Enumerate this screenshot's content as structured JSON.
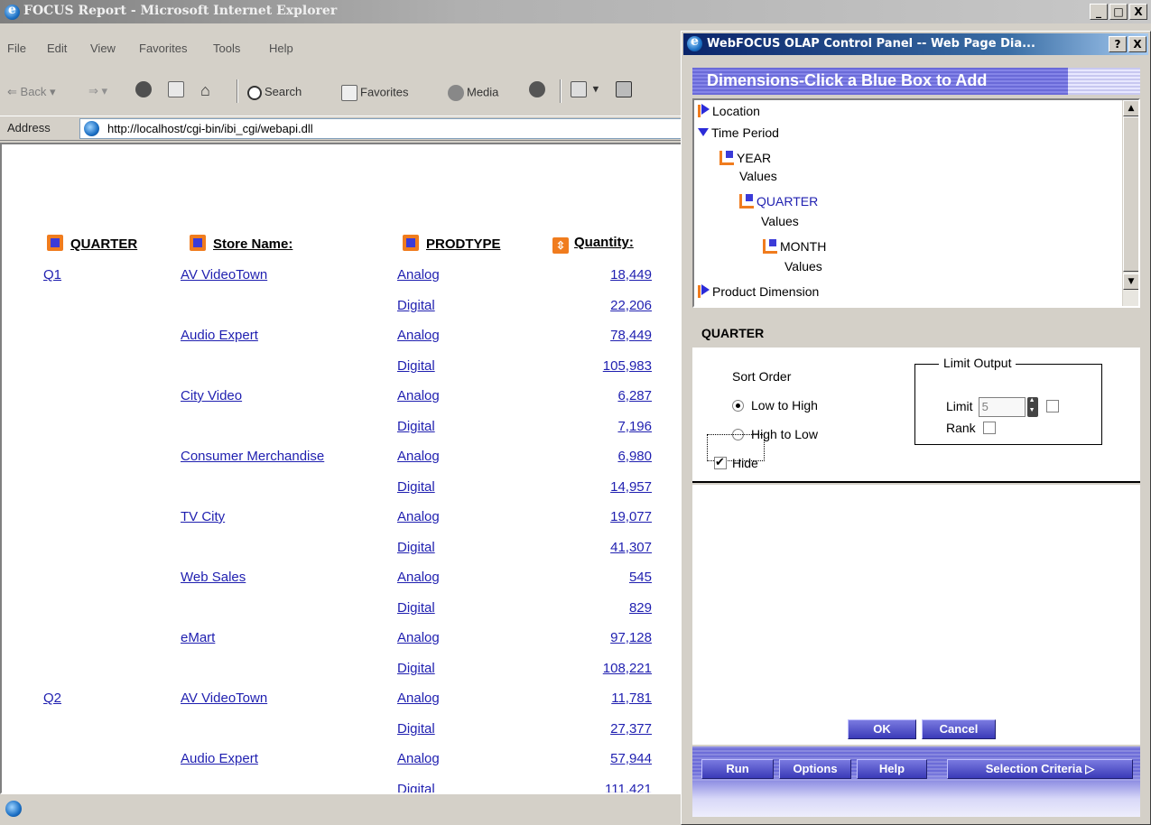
{
  "browser": {
    "title": "FOCUS Report - Microsoft Internet Explorer",
    "window_buttons": [
      "_",
      "□",
      "X"
    ],
    "menu": [
      "File",
      "Edit",
      "View",
      "Favorites",
      "Tools",
      "Help"
    ],
    "toolbar": {
      "back": "Back",
      "search": "Search",
      "favorites": "Favorites",
      "media": "Media"
    },
    "address_label": "Address",
    "address_url": "http://localhost/cgi-bin/ibi_cgi/webapi.dll"
  },
  "report": {
    "headers": {
      "quarter": "QUARTER",
      "store": "Store Name:",
      "prodtype": "PRODTYPE",
      "quantity": "Quantity:"
    },
    "rows": [
      {
        "quarter": "Q1",
        "store": "AV VideoTown",
        "prodtype": "Analog",
        "quantity": "18,449"
      },
      {
        "quarter": "",
        "store": "",
        "prodtype": "Digital",
        "quantity": "22,206"
      },
      {
        "quarter": "",
        "store": "Audio Expert",
        "prodtype": "Analog",
        "quantity": "78,449"
      },
      {
        "quarter": "",
        "store": "",
        "prodtype": "Digital",
        "quantity": "105,983"
      },
      {
        "quarter": "",
        "store": "City Video",
        "prodtype": "Analog",
        "quantity": "6,287"
      },
      {
        "quarter": "",
        "store": "",
        "prodtype": "Digital",
        "quantity": "7,196"
      },
      {
        "quarter": "",
        "store": "Consumer Merchandise",
        "prodtype": "Analog",
        "quantity": "6,980"
      },
      {
        "quarter": "",
        "store": "",
        "prodtype": "Digital",
        "quantity": "14,957"
      },
      {
        "quarter": "",
        "store": "TV City",
        "prodtype": "Analog",
        "quantity": "19,077"
      },
      {
        "quarter": "",
        "store": "",
        "prodtype": "Digital",
        "quantity": "41,307"
      },
      {
        "quarter": "",
        "store": "Web Sales",
        "prodtype": "Analog",
        "quantity": "545"
      },
      {
        "quarter": "",
        "store": "",
        "prodtype": "Digital",
        "quantity": "829"
      },
      {
        "quarter": "",
        "store": "eMart",
        "prodtype": "Analog",
        "quantity": "97,128"
      },
      {
        "quarter": "",
        "store": "",
        "prodtype": "Digital",
        "quantity": "108,221"
      },
      {
        "quarter": "Q2",
        "store": "AV VideoTown",
        "prodtype": "Analog",
        "quantity": "11,781"
      },
      {
        "quarter": "",
        "store": "",
        "prodtype": "Digital",
        "quantity": "27,377"
      },
      {
        "quarter": "",
        "store": "Audio Expert",
        "prodtype": "Analog",
        "quantity": "57,944"
      },
      {
        "quarter": "",
        "store": "",
        "prodtype": "Digital",
        "quantity": "111,421"
      }
    ]
  },
  "dialog": {
    "title": "WebFOCUS OLAP Control Panel -- Web Page Dia...",
    "title_buttons": [
      "?",
      "X"
    ],
    "banner": "Dimensions-Click a Blue Box to Add",
    "tree": {
      "location": "Location",
      "time_period": "Time Period",
      "year": "YEAR",
      "year_values": "Values",
      "quarter": "QUARTER",
      "quarter_values": "Values",
      "month": "MONTH",
      "month_values": "Values",
      "product_dimension": "Product Dimension"
    },
    "section_title": "QUARTER",
    "sort_order_label": "Sort Order",
    "sort_low_high": "Low to High",
    "sort_high_low": "High to Low",
    "selected_sort": "Low to High",
    "hide_label": "Hide",
    "hide_checked": true,
    "limit_output_label": "Limit Output",
    "limit_label": "Limit",
    "limit_value": "5",
    "rank_label": "Rank",
    "ok": "OK",
    "cancel": "Cancel",
    "run": "Run",
    "options": "Options",
    "help": "Help",
    "selection_criteria": "Selection Criteria ▷"
  },
  "colors": {
    "link_blue": "#1f1fb0",
    "orange_marker": "#f07c1e",
    "blue_box": "#3b3bd8",
    "banner_purple": "#6a6ad8"
  }
}
